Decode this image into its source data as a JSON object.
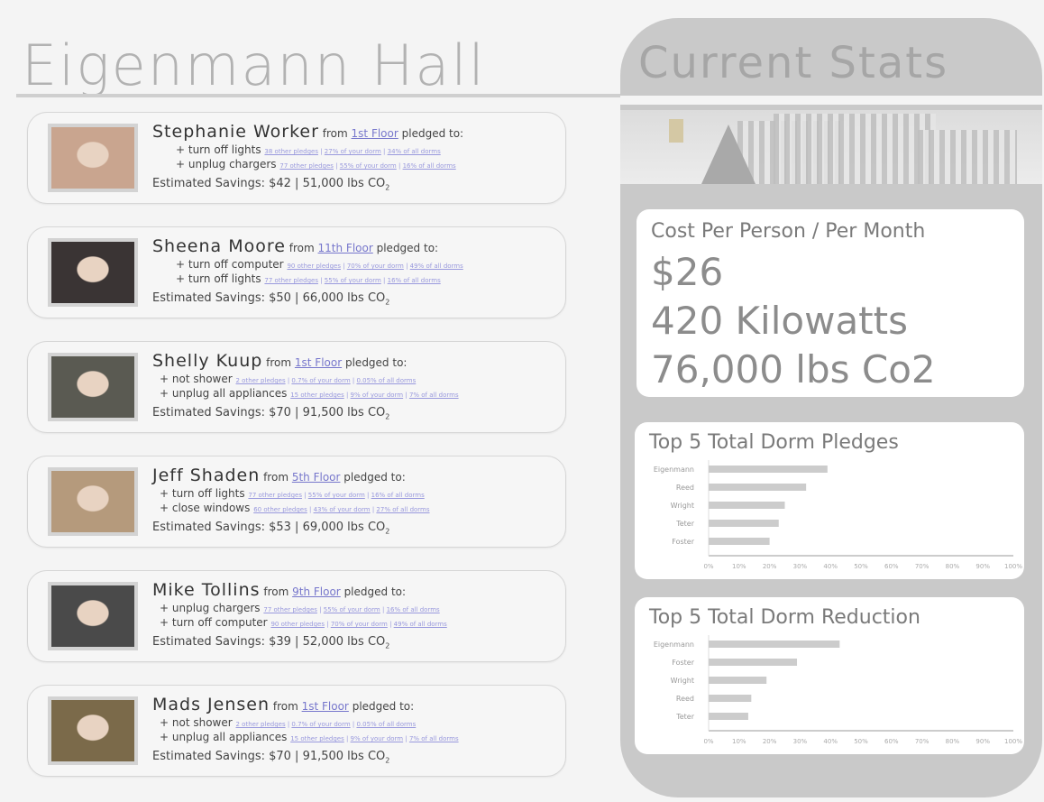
{
  "page": {
    "title": "Eigenmann Hall"
  },
  "pledges": [
    {
      "name": "Stephanie Worker",
      "from": "from",
      "floor": "1st Floor",
      "pledged": "pledged to:",
      "items": [
        {
          "text": "+ turn off lights",
          "links": [
            "38 other pledges",
            "27% of your dorm",
            "34% of all dorms"
          ]
        },
        {
          "text": "+ unplug chargers",
          "links": [
            "77 other pledges",
            "55% of your dorm",
            "16% of all dorms"
          ]
        }
      ],
      "savings": "Estimated Savings: $42 | 51,000 lbs CO",
      "sub": "2"
    },
    {
      "name": "Sheena Moore",
      "from": "from",
      "floor": "11th Floor",
      "pledged": "pledged to:",
      "items": [
        {
          "text": "+ turn off computer",
          "links": [
            "90 other pledges",
            "70% of your dorm",
            "49% of all dorms"
          ]
        },
        {
          "text": "+ turn off lights",
          "links": [
            "77 other pledges",
            "55% of your dorm",
            "16% of all dorms"
          ]
        }
      ],
      "savings": "Estimated Savings: $50 | 66,000 lbs CO",
      "sub": "2"
    },
    {
      "name": "Shelly Kuup",
      "from": "from",
      "floor": "1st Floor",
      "pledged": "pledged to:",
      "items": [
        {
          "text": "+ not shower",
          "links": [
            "2 other pledges",
            "0.7% of your dorm",
            "0.05% of all dorms"
          ]
        },
        {
          "text": "+ unplug all appliances",
          "links": [
            "15 other pledges",
            "9% of your dorm",
            "7% of all dorms"
          ]
        }
      ],
      "savings": "Estimated Savings: $70 | 91,500 lbs CO",
      "sub": "2"
    },
    {
      "name": "Jeff Shaden",
      "from": "from",
      "floor": "5th Floor",
      "pledged": "pledged to:",
      "items": [
        {
          "text": "+ turn off lights",
          "links": [
            "77 other pledges",
            "55% of your dorm",
            "16% of all dorms"
          ]
        },
        {
          "text": "+ close windows",
          "links": [
            "60 other pledges",
            "43% of your dorm",
            "27% of all dorms"
          ]
        }
      ],
      "savings": "Estimated Savings: $53 | 69,000 lbs CO",
      "sub": "2"
    },
    {
      "name": "Mike Tollins",
      "from": "from",
      "floor": "9th Floor",
      "pledged": "pledged to:",
      "items": [
        {
          "text": "+ unplug chargers",
          "links": [
            "77 other pledges",
            "55% of your dorm",
            "16% of all dorms"
          ]
        },
        {
          "text": "+ turn off computer",
          "links": [
            "90 other pledges",
            "70% of your dorm",
            "49% of all dorms"
          ]
        }
      ],
      "savings": "Estimated Savings: $39 | 52,000 lbs CO",
      "sub": "2"
    },
    {
      "name": "Mads Jensen",
      "from": "from",
      "floor": "1st Floor",
      "pledged": "pledged to:",
      "items": [
        {
          "text": "+ not shower",
          "links": [
            "2 other pledges",
            "0.7% of your dorm",
            "0.05% of all dorms"
          ]
        },
        {
          "text": "+ unplug all appliances",
          "links": [
            "15 other pledges",
            "9% of your dorm",
            "7% of all dorms"
          ]
        }
      ],
      "savings": "Estimated Savings: $70 | 91,500 lbs CO",
      "sub": "2"
    }
  ],
  "stats": {
    "title": "Current Stats",
    "cost_heading": "Cost Per Person / Per Month",
    "cost": "$26",
    "kilowatts": "420 Kilowatts",
    "co2": "76,000 lbs Co2"
  },
  "chart_data": [
    {
      "type": "bar",
      "orientation": "horizontal",
      "title": "Top 5 Total Dorm Pledges",
      "categories": [
        "Eigenmann",
        "Reed",
        "Wright",
        "Teter",
        "Foster"
      ],
      "values": [
        39,
        32,
        25,
        23,
        20
      ],
      "xticks": [
        "0%",
        "10%",
        "20%",
        "30%",
        "40%",
        "50%",
        "60%",
        "70%",
        "80%",
        "90%",
        "100%"
      ],
      "xlim": [
        0,
        100
      ],
      "bar_color": "#cccccc"
    },
    {
      "type": "bar",
      "orientation": "horizontal",
      "title": "Top 5 Total Dorm Reduction",
      "categories": [
        "Eigenmann",
        "Foster",
        "Wright",
        "Reed",
        "Teter"
      ],
      "values": [
        43,
        29,
        19,
        14,
        13
      ],
      "xticks": [
        "0%",
        "10%",
        "20%",
        "30%",
        "40%",
        "50%",
        "60%",
        "70%",
        "80%",
        "90%",
        "100%"
      ],
      "xlim": [
        0,
        100
      ],
      "bar_color": "#cccccc"
    }
  ],
  "colors": {
    "link": "#7777cc",
    "accent_gray": "#c9c9c9"
  }
}
